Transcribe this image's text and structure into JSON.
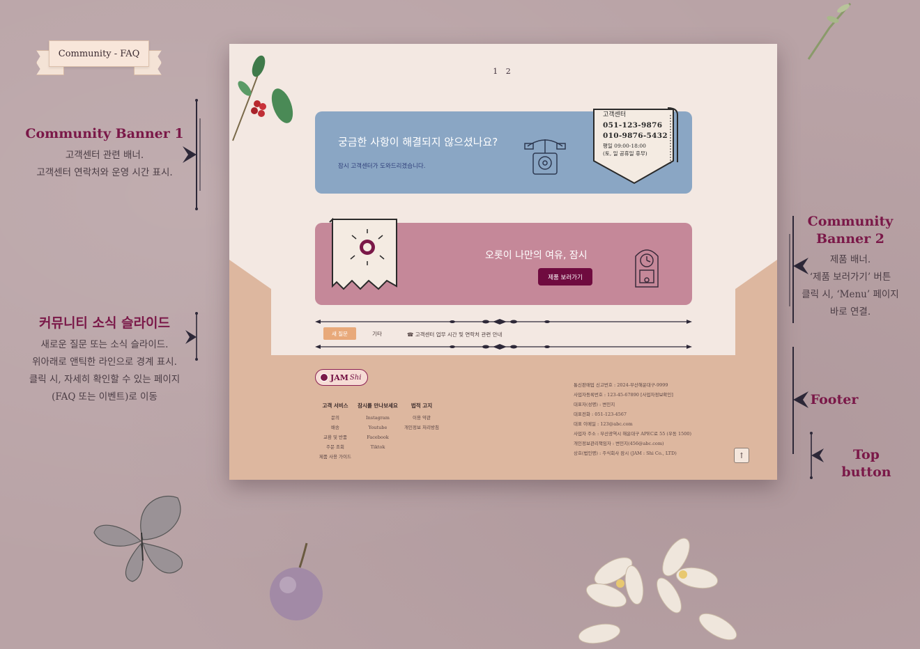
{
  "tag": {
    "label": "Community - FAQ"
  },
  "annotations": {
    "banner1": {
      "title": "Community Banner 1",
      "desc": [
        "고객센터 관련 배너.",
        "고객센터 연락처와 운영 시간 표시."
      ]
    },
    "slide": {
      "title": "커뮤니티 소식 슬라이드",
      "desc": [
        "새로운 질문 또는 소식 슬라이드.",
        "위아래로 앤틱한 라인으로 경계 표시.",
        "클릭 시, 자세히 확인할 수 있는 페이지",
        "(FAQ 또는 이벤트)로 이동"
      ]
    },
    "banner2": {
      "title_line1": "Community",
      "title_line2": "Banner 2",
      "desc": [
        "제품 배너.",
        "‘제품 보러가기’ 버튼",
        "클릭 시, ‘Menu’ 페이지",
        "바로 연결."
      ]
    },
    "footer": {
      "title": "Footer"
    },
    "topbutton": {
      "title": "Top button"
    }
  },
  "page": {
    "pagination": [
      "1",
      "2"
    ],
    "banner1": {
      "title": "궁금한 사항이 해결되지 않으셨나요?",
      "subtitle": "잠시 고객센터가 도와드리겠습니다.",
      "card": {
        "label": "고객센터",
        "phone1": "051-123-9876",
        "phone2": "010-9876-5432",
        "hours": "평일 09:00-18:00",
        "closed": "(토, 일 공휴일 휴무)"
      }
    },
    "banner2": {
      "title": "오롯이 나만의 여유, 잠시",
      "button": "제품 보러가기"
    },
    "slide": {
      "tab_active": "새 질문",
      "tab_other": "기타",
      "text": "☎ 고객센터 업무 시간 및 연락처 관련 안내"
    },
    "footer": {
      "logo": {
        "main": "JAM",
        "script": "Shi"
      },
      "columns": [
        {
          "heading": "고객 서비스",
          "links": [
            "문의",
            "배송",
            "교환 및 반품",
            "주문 조회",
            "제품 사용 가이드"
          ]
        },
        {
          "heading": "잠시를 만나보세요",
          "links": [
            "Instagram",
            "Youtube",
            "Facebook",
            "Tiktok"
          ]
        },
        {
          "heading": "법적 고지",
          "links": [
            "이용 약관",
            "개인정보 처리방침"
          ]
        }
      ],
      "info": [
        "통신판매업 신고번호 : 2024-부산해운대구-9999",
        "사업자등록번호 : 123-45-67890 [사업자정보확인]",
        "대표자(성명) : 변민지",
        "대표전화 : 051-123-4567",
        "대표 이메일 : 123@abc.com",
        "사업자 주소 : 부산광역시 해운대구 APEC로 55 (우동 1500)",
        "개인정보관리책임자 : 변민지(456@abc.com)",
        "상호(법인명) : 주식회사 잠시 (JAM : Shi Co., LTD)"
      ],
      "top_button": "↑"
    }
  },
  "colors": {
    "accent": "#7a1848",
    "banner1": "#8aa6c4",
    "banner2": "#c58899",
    "button": "#6f0b3f",
    "footer": "#ddb79f",
    "paper": "#f3e8e2"
  }
}
